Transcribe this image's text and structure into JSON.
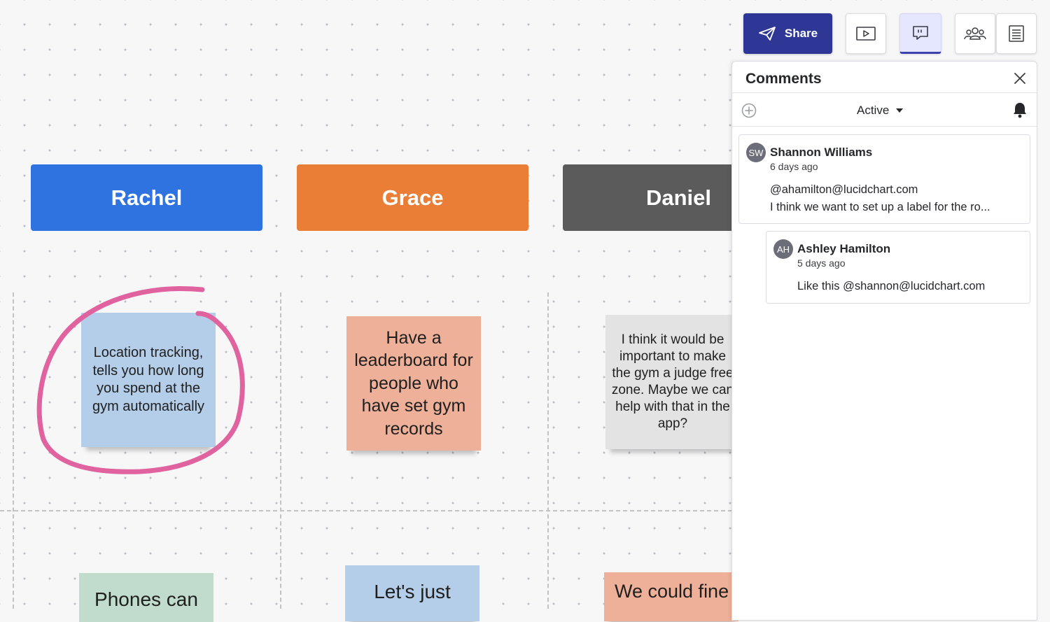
{
  "toolbar": {
    "share_label": "Share"
  },
  "board": {
    "columns": [
      {
        "name": "Rachel",
        "color": "#2f73e0"
      },
      {
        "name": "Grace",
        "color": "#ea7e36"
      },
      {
        "name": "Daniel",
        "color": "#5b5b5b"
      }
    ],
    "stickies": [
      {
        "text": "Location tracking, tells you how long you spend at the gym automatically",
        "color": "#b4cde8",
        "highlighted": true,
        "highlight_color": "#e063a0"
      },
      {
        "text": "Have a leaderboard for people who have set gym records",
        "color": "#eeb098"
      },
      {
        "text": "I think it would be important to make the gym a judge free zone. Maybe we can help with that in the app?",
        "color": "#e3e3e3"
      },
      {
        "text": "Phones can",
        "color": "#c1dccc"
      },
      {
        "text": "Let's just",
        "color": "#b4cde8"
      },
      {
        "text": "We could fine",
        "color": "#eeb098"
      }
    ]
  },
  "comments_panel": {
    "title": "Comments",
    "filter_label": "Active",
    "threads": [
      {
        "initials": "SW",
        "author": "Shannon Williams",
        "time": "6 days ago",
        "mention": "@ahamilton@lucidchart.com",
        "text": "I think we want to set up a label for the ro..."
      },
      {
        "initials": "AH",
        "author": "Ashley Hamilton",
        "time": "5 days ago",
        "text": "Like this @shannon@lucidchart.com"
      }
    ]
  },
  "icons": {
    "share": "paper-plane-icon",
    "present": "play-icon",
    "comments": "comment-icon",
    "collaborators": "people-icon",
    "notes": "document-icon",
    "close": "close-icon",
    "add": "plus-circle-icon",
    "notifications": "bell-icon",
    "filter_caret": "caret-down-icon"
  }
}
